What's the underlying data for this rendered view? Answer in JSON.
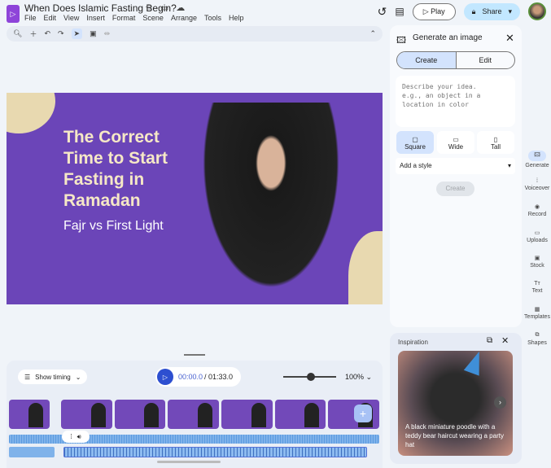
{
  "app": {
    "title": "When Does Islamic Fasting Begin?",
    "menu": [
      "File",
      "Edit",
      "View",
      "Insert",
      "Format",
      "Scene",
      "Arrange",
      "Tools",
      "Help"
    ],
    "play": "Play",
    "share": "Share"
  },
  "slide": {
    "heading": "The Correct Time to Start Fasting in Ramadan",
    "subheading": "Fajr vs First Light"
  },
  "timeline": {
    "show_timing": "Show timing",
    "current_time": "00:00.0",
    "total_time": "/ 01:33.0",
    "zoom": "100%",
    "zoom_level": 0.45
  },
  "panel": {
    "title": "Generate an image",
    "tabs": [
      "Create",
      "Edit"
    ],
    "prompt_placeholder": "Describe your idea.\ne.g., an object in a location in color",
    "shapes": [
      "Square",
      "Wide",
      "Tall"
    ],
    "style": "Add a style",
    "create": "Create"
  },
  "rail": [
    "Generate",
    "Voiceover",
    "Record",
    "Uploads",
    "Stock",
    "Text",
    "Templates",
    "Shapes"
  ],
  "inspiration": {
    "title": "Inspiration",
    "caption": "A black miniature poodle with a teddy bear haircut wearing a party hat"
  }
}
